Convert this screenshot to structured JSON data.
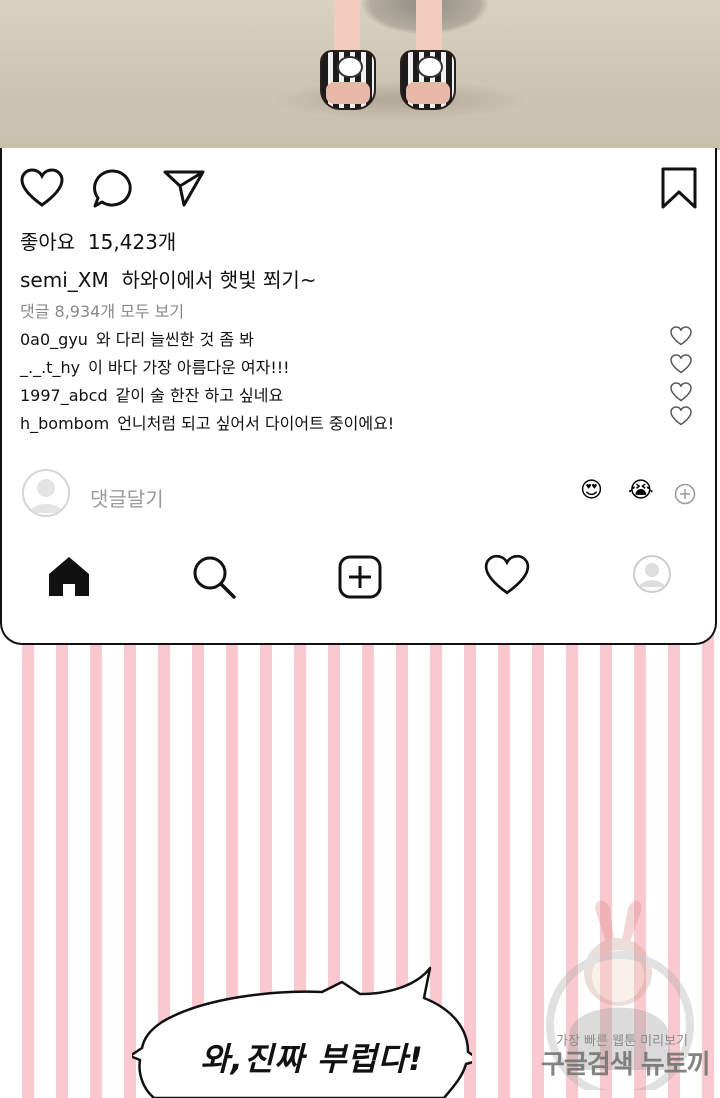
{
  "post": {
    "likes_label": "좋아요",
    "likes_count": "15,423개",
    "username": "semi_XM",
    "caption": "하와이에서 햇빛 쬐기~",
    "view_all_comments": "댓글 8,934개 모두 보기",
    "comments": [
      {
        "user": "0a0_gyu",
        "text": "와 다리 늘씬한 것 좀 봐"
      },
      {
        "user": "_._.t_hy",
        "text": "이 바다 가장 아름다운 여자!!!"
      },
      {
        "user": "1997_abcd",
        "text": "같이 술 한잔 하고 싶네요"
      },
      {
        "user": "h_bombom",
        "text": "언니처럼 되고 싶어서 다이어트 중이에요!"
      }
    ],
    "add_comment_placeholder": "댓글달기",
    "quick_emojis": [
      "😍",
      "😭"
    ]
  },
  "icons": {
    "actions": [
      "heart-icon",
      "comment-icon",
      "send-icon",
      "bookmark-icon"
    ],
    "nav": [
      "home-icon",
      "search-icon",
      "add-post-icon",
      "activity-heart-icon",
      "profile-icon"
    ]
  },
  "speech_bubble": {
    "text": "와,진짜 부럽다!"
  },
  "watermark": {
    "line1": "가장 빠른 웹툰 미리보기",
    "line2": "구글검색 뉴토끼"
  },
  "colors": {
    "stripe_pink": "#f9c9cf",
    "card_border": "#111111",
    "muted_text": "#888888"
  }
}
